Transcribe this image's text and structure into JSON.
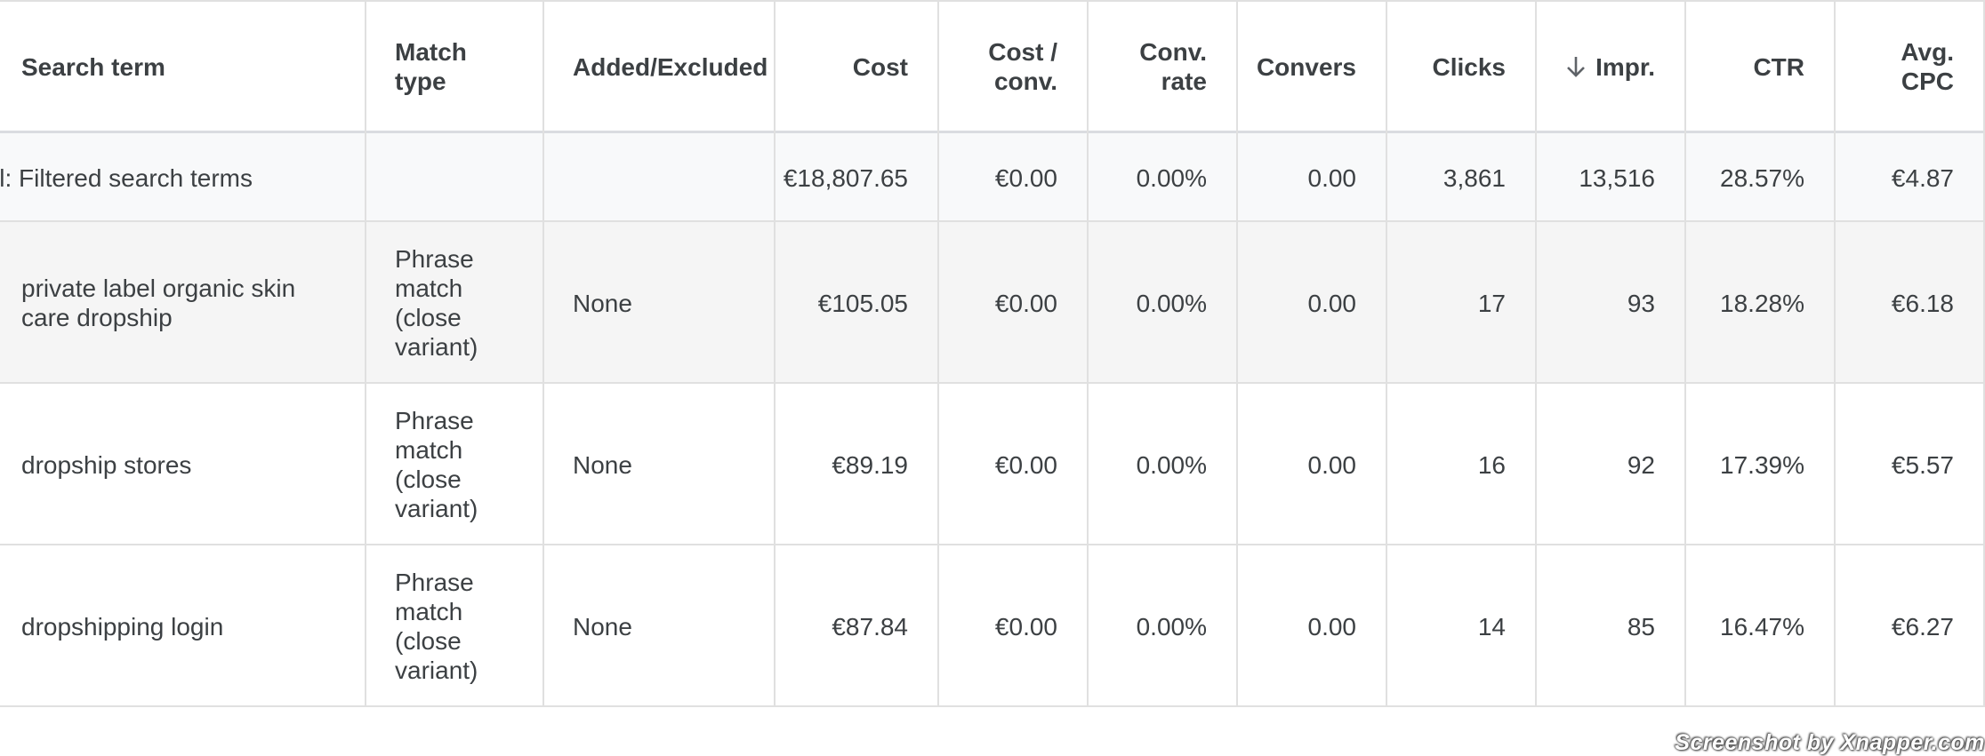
{
  "table": {
    "columns": [
      {
        "key": "search_term",
        "label": "Search term",
        "align": "left"
      },
      {
        "key": "match_type",
        "label": "Match\ntype",
        "align": "left"
      },
      {
        "key": "added_excluded",
        "label": "Added/Excluded",
        "align": "left"
      },
      {
        "key": "cost",
        "label": "Cost",
        "align": "right"
      },
      {
        "key": "cost_per_conv",
        "label": "Cost /\nconv.",
        "align": "right"
      },
      {
        "key": "conv_rate",
        "label": "Conv.\nrate",
        "align": "right"
      },
      {
        "key": "conversions",
        "label": "Convers",
        "align": "right"
      },
      {
        "key": "clicks",
        "label": "Clicks",
        "align": "right"
      },
      {
        "key": "impressions",
        "label": "Impr.",
        "align": "right",
        "sorted": "descending",
        "sort_icon": "arrow-down-icon"
      },
      {
        "key": "ctr",
        "label": "CTR",
        "align": "right"
      },
      {
        "key": "avg_cpc",
        "label": "Avg.\nCPC",
        "align": "right"
      }
    ],
    "total_row": {
      "search_term": "Total: Filtered search terms",
      "match_type": "",
      "added_excluded": "",
      "cost": "€18,807.65",
      "cost_per_conv": "€0.00",
      "conv_rate": "0.00%",
      "conversions": "0.00",
      "clicks": "3,861",
      "impressions": "13,516",
      "ctr": "28.57%",
      "avg_cpc": "€4.87"
    },
    "rows": [
      {
        "search_term": "private label organic skin\ncare dropship",
        "match_type": "Phrase\nmatch\n(close\nvariant)",
        "added_excluded": "None",
        "cost": "€105.05",
        "cost_per_conv": "€0.00",
        "conv_rate": "0.00%",
        "conversions": "0.00",
        "clicks": "17",
        "impressions": "93",
        "ctr": "18.28%",
        "avg_cpc": "€6.18"
      },
      {
        "search_term": "dropship stores",
        "match_type": "Phrase\nmatch\n(close\nvariant)",
        "added_excluded": "None",
        "cost": "€89.19",
        "cost_per_conv": "€0.00",
        "conv_rate": "0.00%",
        "conversions": "0.00",
        "clicks": "16",
        "impressions": "92",
        "ctr": "17.39%",
        "avg_cpc": "€5.57"
      },
      {
        "search_term": "dropshipping login",
        "match_type": "Phrase\nmatch\n(close\nvariant)",
        "added_excluded": "None",
        "cost": "€87.84",
        "cost_per_conv": "€0.00",
        "conv_rate": "0.00%",
        "conversions": "0.00",
        "clicks": "14",
        "impressions": "85",
        "ctr": "16.47%",
        "avg_cpc": "€6.27"
      }
    ]
  },
  "colors": {
    "header_bg": "#ffffff",
    "total_bg": "#f8f9fa",
    "highlight_row_bg": "#f5f5f5",
    "row_bg": "#ffffff",
    "border": "#e0e0e0",
    "text": "#3c4043"
  },
  "watermark": "Screenshot by Xnapper.com"
}
